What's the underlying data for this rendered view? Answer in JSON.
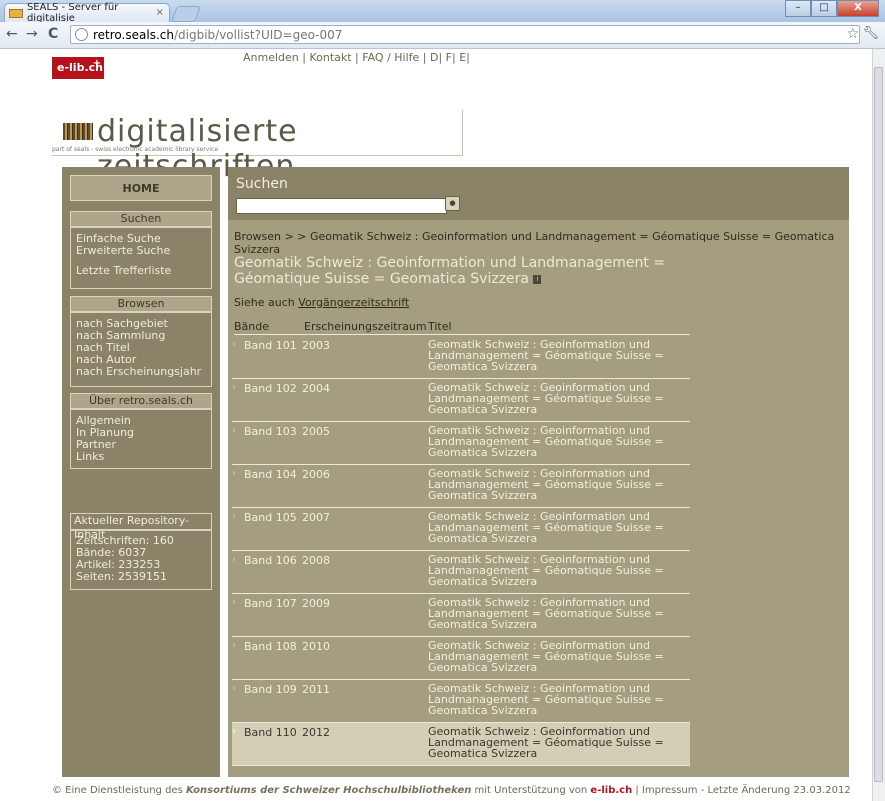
{
  "browser": {
    "tab_title": "SEALS - Server für digitalisie",
    "tab_close": "×",
    "url_host": "retro.seals.ch",
    "url_path": "/digbib/vollist?UID=geo-007",
    "window_buttons": [
      "–",
      "□",
      "X"
    ]
  },
  "header": {
    "elib_logo": "e-lib.ch",
    "top_links": "Anmelden | Kontakt | FAQ / Hilfe | D| F| E|",
    "logo_title": "digitalisierte zeitschriften",
    "logo_subtitle": "part of seals - swiss electronic academic library service"
  },
  "sidebar": {
    "home": "HOME",
    "search_head": "Suchen",
    "search_links": [
      "Einfache Suche",
      "Erweiterte Suche",
      "Letzte Trefferliste"
    ],
    "browse_head": "Browsen",
    "browse_links": [
      "nach Sachgebiet",
      "nach Sammlung",
      "nach Titel",
      "nach Autor",
      "nach Erscheinungsjahr"
    ],
    "about_head": "Über retro.seals.ch",
    "about_links": [
      "Allgemein",
      "In Planung",
      "Partner",
      "Links"
    ],
    "repo_head": "Aktueller Repository-Inhalt",
    "repo_stats": [
      "Zeitschriften: 160",
      "Bände: 6037",
      "Artikel: 233253",
      "Seiten: 2539151"
    ]
  },
  "search": {
    "label": "Suchen",
    "input_value": ""
  },
  "main": {
    "breadcrumb": "Browsen > > Geomatik Schweiz : Geoinformation und Landmanagement = Géomatique Suisse = Geomatica Svizzera",
    "heading": "Geomatik Schweiz : Geoinformation und Landmanagement = Géomatique Suisse = Geomatica Svizzera",
    "info_icon": "i",
    "siehe_prefix": "Siehe auch ",
    "siehe_link": "Vorgängerzeitschrift",
    "columns": [
      "Bände",
      "Erscheinungszeitraum",
      "Titel"
    ],
    "rows": [
      {
        "band": "Band 101",
        "year": "2003",
        "title": "Geomatik Schweiz : Geoinformation und Landmanagement = Géomatique Suisse = Geomatica Svizzera"
      },
      {
        "band": "Band 102",
        "year": "2004",
        "title": "Geomatik Schweiz : Geoinformation und Landmanagement = Géomatique Suisse = Geomatica Svizzera"
      },
      {
        "band": "Band 103",
        "year": "2005",
        "title": "Geomatik Schweiz : Geoinformation und Landmanagement = Géomatique Suisse = Geomatica Svizzera"
      },
      {
        "band": "Band 104",
        "year": "2006",
        "title": "Geomatik Schweiz : Geoinformation und Landmanagement = Géomatique Suisse = Geomatica Svizzera"
      },
      {
        "band": "Band 105",
        "year": "2007",
        "title": "Geomatik Schweiz : Geoinformation und Landmanagement = Géomatique Suisse = Geomatica Svizzera"
      },
      {
        "band": "Band 106",
        "year": "2008",
        "title": "Geomatik Schweiz : Geoinformation und Landmanagement = Géomatique Suisse = Geomatica Svizzera"
      },
      {
        "band": "Band 107",
        "year": "2009",
        "title": "Geomatik Schweiz : Geoinformation und Landmanagement = Géomatique Suisse = Geomatica Svizzera"
      },
      {
        "band": "Band 108",
        "year": "2010",
        "title": "Geomatik Schweiz : Geoinformation und Landmanagement = Géomatique Suisse = Geomatica Svizzera"
      },
      {
        "band": "Band 109",
        "year": "2011",
        "title": "Geomatik Schweiz : Geoinformation und Landmanagement = Géomatique Suisse = Geomatica Svizzera"
      },
      {
        "band": "Band 110",
        "year": "2012",
        "title": "Geomatik Schweiz : Geoinformation und Landmanagement = Géomatique Suisse = Geomatica Svizzera"
      }
    ]
  },
  "footer": {
    "prefix": "© Eine Dienstleistung des ",
    "konsortium": "Konsortiums der Schweizer Hochschulbibliotheken",
    "middle": " mit Unterstützung von ",
    "elib": "e-lib.ch",
    "suffix": "  |  Impressum - Letzte Änderung 23.03.2012"
  },
  "colors": {
    "sidebar_bg": "#8b8368",
    "content_bg": "#a49d7f",
    "highlight_bg": "#d2cfb6",
    "elib_red": "#b5121b"
  }
}
